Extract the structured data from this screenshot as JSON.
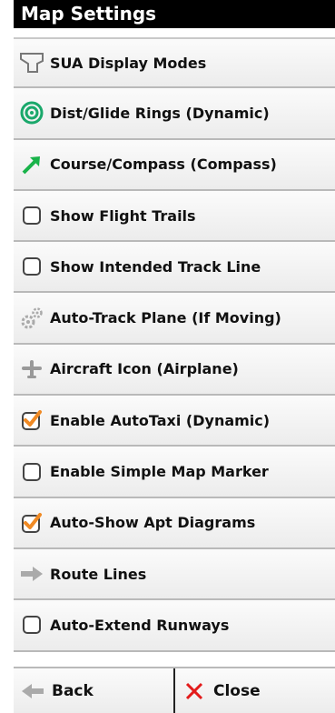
{
  "title": "Map Settings",
  "items": [
    {
      "label": "SUA Display Modes",
      "icon": "airspace-icon"
    },
    {
      "label": "Dist/Glide Rings (Dynamic)",
      "icon": "rings-icon"
    },
    {
      "label": "Course/Compass (Compass)",
      "icon": "course-arrow-icon"
    },
    {
      "label": "Show Flight Trails",
      "icon": "checkbox-unchecked-icon",
      "checked": false
    },
    {
      "label": "Show Intended Track Line",
      "icon": "checkbox-unchecked-icon",
      "checked": false
    },
    {
      "label": "Auto-Track Plane (If Moving)",
      "icon": "gears-icon"
    },
    {
      "label": "Aircraft Icon (Airplane)",
      "icon": "airplane-icon"
    },
    {
      "label": "Enable AutoTaxi (Dynamic)",
      "icon": "checkbox-checked-icon",
      "checked": true
    },
    {
      "label": "Enable Simple Map Marker",
      "icon": "checkbox-unchecked-icon",
      "checked": false
    },
    {
      "label": "Auto-Show Apt Diagrams",
      "icon": "checkbox-checked-icon",
      "checked": true
    },
    {
      "label": "Route Lines",
      "icon": "route-arrow-icon"
    },
    {
      "label": "Auto-Extend Runways",
      "icon": "checkbox-unchecked-icon",
      "checked": false
    }
  ],
  "bottom": {
    "back_label": "Back",
    "close_label": "Close"
  },
  "colors": {
    "check_orange": "#f08a24",
    "close_red": "#e31b1b",
    "rings_green": "#1aa86b",
    "course_green": "#19b34a"
  }
}
